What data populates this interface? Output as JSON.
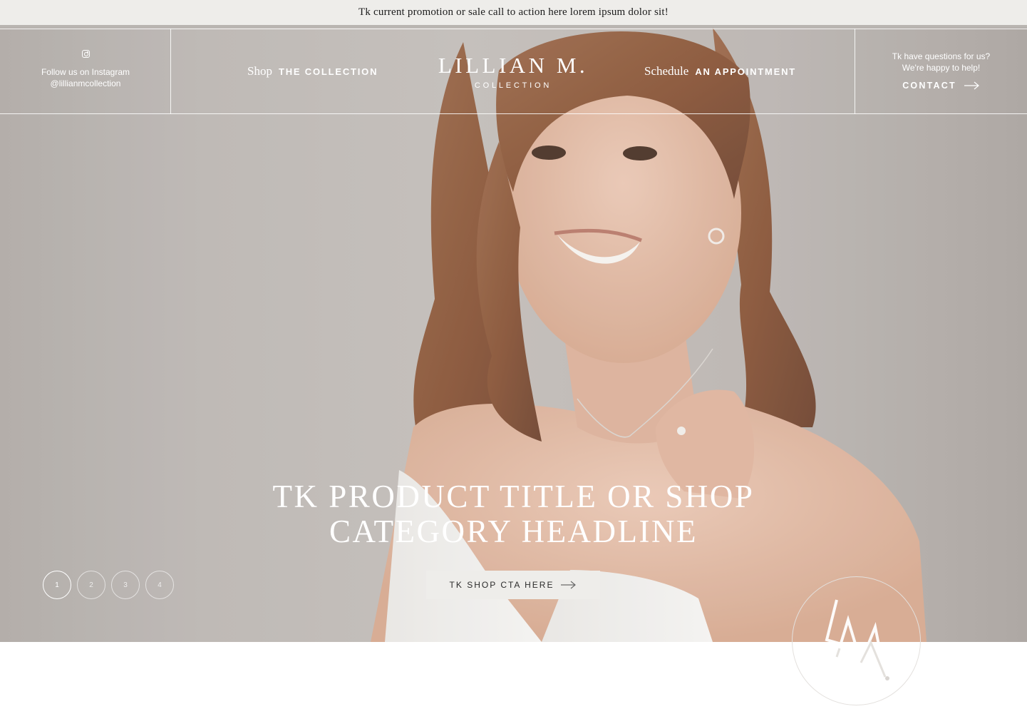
{
  "promo": {
    "text": "Tk current promotion or sale call to action here lorem ipsum dolor sit!"
  },
  "header": {
    "instagram": {
      "icon": "instagram-icon",
      "line1": "Follow us on Instagram",
      "line2": "@lillianmcollection"
    },
    "nav_shop": {
      "script": "Shop",
      "caps": "THE COLLECTION"
    },
    "logo": {
      "main": "LILLIAN M.",
      "sub": "COLLECTION"
    },
    "nav_schedule": {
      "script": "Schedule",
      "caps": "AN APPOINTMENT"
    },
    "contact": {
      "line1": "Tk have questions for us?",
      "line2": "We're happy to help!",
      "link": "CONTACT",
      "icon": "arrow-right-icon"
    }
  },
  "hero": {
    "headline_line1": "TK PRODUCT TITLE OR SHOP",
    "headline_line2": "CATEGORY HEADLINE",
    "cta_label": "TK SHOP CTA HERE",
    "slides": [
      "1",
      "2",
      "3",
      "4"
    ],
    "active_slide": "1"
  },
  "badge": {
    "monogram": "LM.",
    "icon": "monogram-logo-icon"
  },
  "colors": {
    "promo_bg": "#eeedea",
    "hero_bg": "#bdb8b4",
    "text_light": "#ffffff",
    "cta_bg": "#eeedea"
  }
}
